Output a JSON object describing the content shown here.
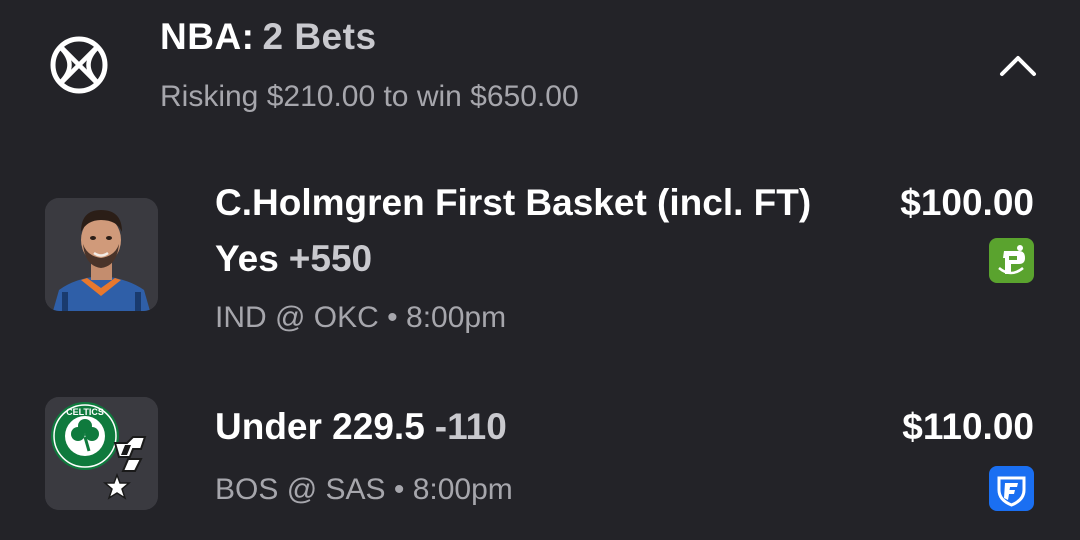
{
  "header": {
    "league": "NBA:",
    "bet_count": "2 Bets",
    "summary": "Risking $210.00 to win $650.00",
    "sport_icon": "basketball-icon",
    "collapse_icon": "chevron-up-icon"
  },
  "bets": [
    {
      "market": "C.Holmgren First Basket (incl. FT)",
      "selection": "Yes",
      "odds": "+550",
      "stake": "$100.00",
      "matchup": "IND @ OKC",
      "separator": "•",
      "time": "8:00pm",
      "thumbnail": "player-photo",
      "sportsbook_icon": "draftkings-icon"
    },
    {
      "market": "Under 229.5",
      "odds": "-110",
      "stake": "$110.00",
      "matchup": "BOS @ SAS",
      "separator": "•",
      "time": "8:00pm",
      "thumbnail": "celtics-spurs-logos",
      "celtics_logo_text": "CELTICS",
      "sportsbook_icon": "fanduel-icon"
    }
  ],
  "colors": {
    "background": "#232328",
    "secondary_text": "#a6a6ac",
    "draftkings_green": "#5aa32e",
    "fanduel_blue": "#1a6ff2",
    "celtics_green": "#0f7a3d"
  }
}
